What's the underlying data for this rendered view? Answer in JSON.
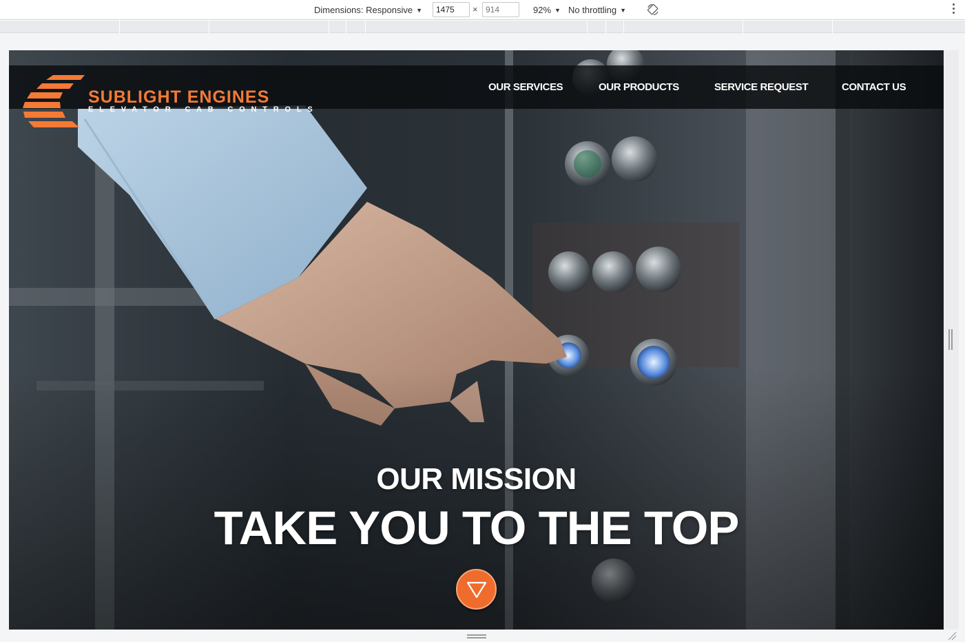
{
  "devtools": {
    "dimensions_label": "Dimensions: Responsive",
    "width_value": "1475",
    "times_symbol": "×",
    "height_placeholder": "914",
    "zoom": "92%",
    "throttling": "No throttling",
    "icons": [
      "chevron-down-icon",
      "rotate-icon",
      "more-vertical-icon"
    ]
  },
  "site": {
    "logo": {
      "title": "SUBLIGHT ENGINES",
      "subtitle": "ELEVATOR CAB CONTROLS"
    },
    "nav": [
      {
        "label": "OUR SERVICES"
      },
      {
        "label": "OUR PRODUCTS"
      },
      {
        "label": "SERVICE REQUEST"
      },
      {
        "label": "CONTACT US"
      }
    ],
    "hero": {
      "kicker": "OUR MISSION",
      "headline": "TAKE YOU TO THE TOP",
      "scroll_icon": "triangle-down-icon"
    }
  },
  "colors": {
    "brand_orange": "#f47a35",
    "button_orange": "#ef6c2c",
    "header_bg": "#0a0c0f",
    "devtools_bg": "#ffffff"
  }
}
